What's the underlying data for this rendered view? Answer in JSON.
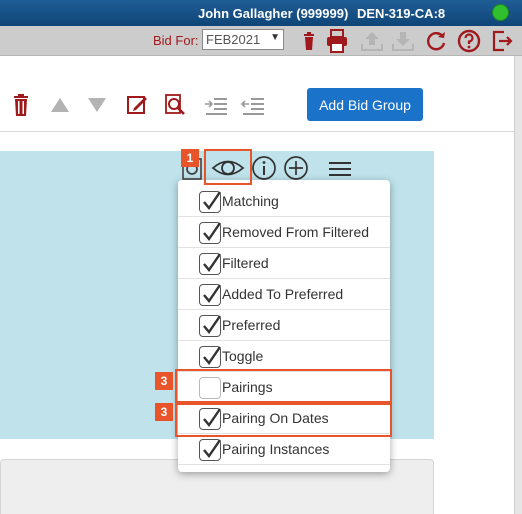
{
  "header": {
    "user": "John Gallagher (999999)",
    "domicile": "DEN-319-CA:8",
    "status_color": "#2fbf2f"
  },
  "bidbar": {
    "bid_for_label": "Bid For:",
    "bid_period": "FEB2021",
    "icons": [
      "trash-icon",
      "print-icon",
      "upload-icon",
      "download-icon",
      "refresh-icon",
      "help-icon",
      "logout-icon"
    ]
  },
  "toolbar": {
    "icons": [
      "delete-icon",
      "move-up-icon",
      "move-down-icon",
      "edit-icon",
      "preview-icon",
      "indent-icon",
      "outdent-icon"
    ],
    "add_bid_group_label": "Add Bid Group"
  },
  "panel": {
    "icons": [
      "search-icon",
      "eye-icon",
      "info-icon",
      "add-icon",
      "list-menu-icon"
    ]
  },
  "visibility_menu": {
    "items": [
      {
        "label": "Matching",
        "checked": true
      },
      {
        "label": "Removed From Filtered",
        "checked": true
      },
      {
        "label": "Filtered",
        "checked": true
      },
      {
        "label": "Added To Preferred",
        "checked": true
      },
      {
        "label": "Preferred",
        "checked": true
      },
      {
        "label": "Toggle",
        "checked": true
      },
      {
        "label": "Pairings",
        "checked": false
      },
      {
        "label": "Pairing On Dates",
        "checked": true
      },
      {
        "label": "Pairing Instances",
        "checked": true
      }
    ]
  },
  "annotations": [
    {
      "number": "1",
      "target": "eye-icon"
    },
    {
      "number": "3",
      "target": "Pairings"
    },
    {
      "number": "3",
      "target": "Pairing On Dates"
    }
  ],
  "colors": {
    "header_blue": "#1a4f84",
    "accent_red": "#a0191c",
    "button_blue": "#1a73c9",
    "panel_teal": "#bfe2eb",
    "callout_orange": "#e8552a"
  }
}
